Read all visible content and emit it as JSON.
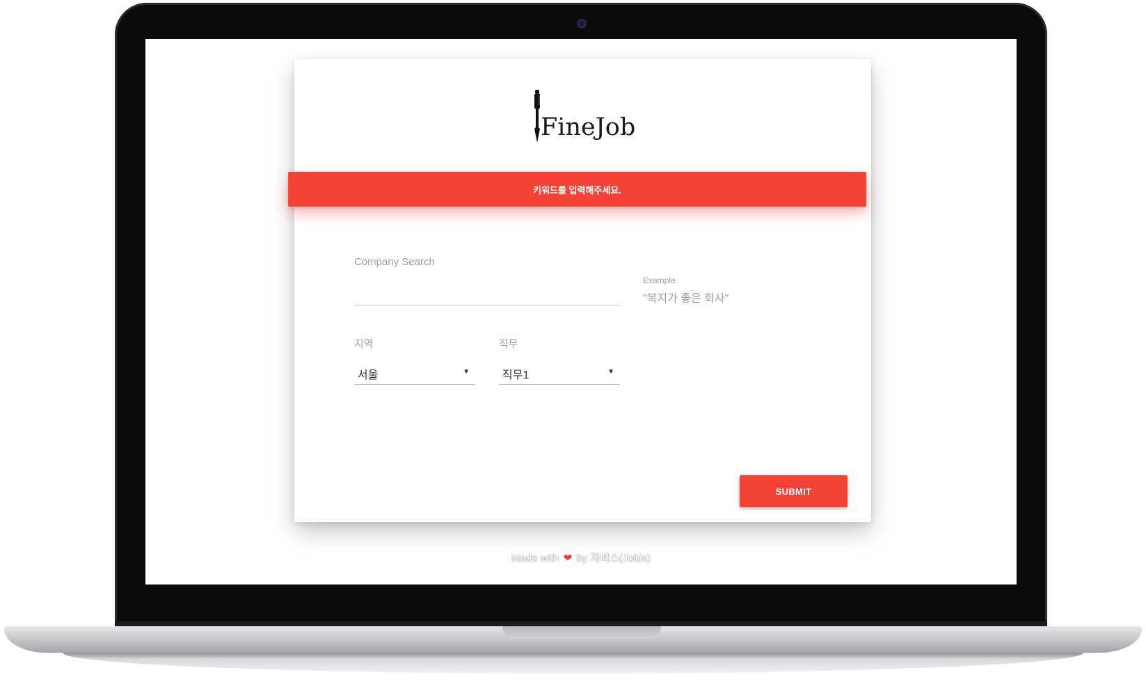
{
  "brand": {
    "name": "FineJob",
    "logo_icon": "pen-icon"
  },
  "alert": {
    "message": "키워드를 입력해주세요.",
    "color": "#f44336"
  },
  "search": {
    "label": "Company Search",
    "value": "",
    "example_label": "Example",
    "example_text": "\"복지가 좋은 회사\""
  },
  "region": {
    "label": "지역",
    "selected": "서울",
    "arrow_icon": "dropdown-arrow-icon"
  },
  "job": {
    "label": "직무",
    "selected": "직무1",
    "arrow_icon": "dropdown-arrow-icon"
  },
  "submit": {
    "label": "SUBMIT",
    "color": "#f44336"
  },
  "footer": {
    "made_with": "Made with",
    "heart_icon": "heart-icon",
    "by": "by",
    "author": "자비스(Jobis)"
  },
  "device": {
    "frame": "laptop-frame",
    "camera_icon": "webcam-icon"
  }
}
